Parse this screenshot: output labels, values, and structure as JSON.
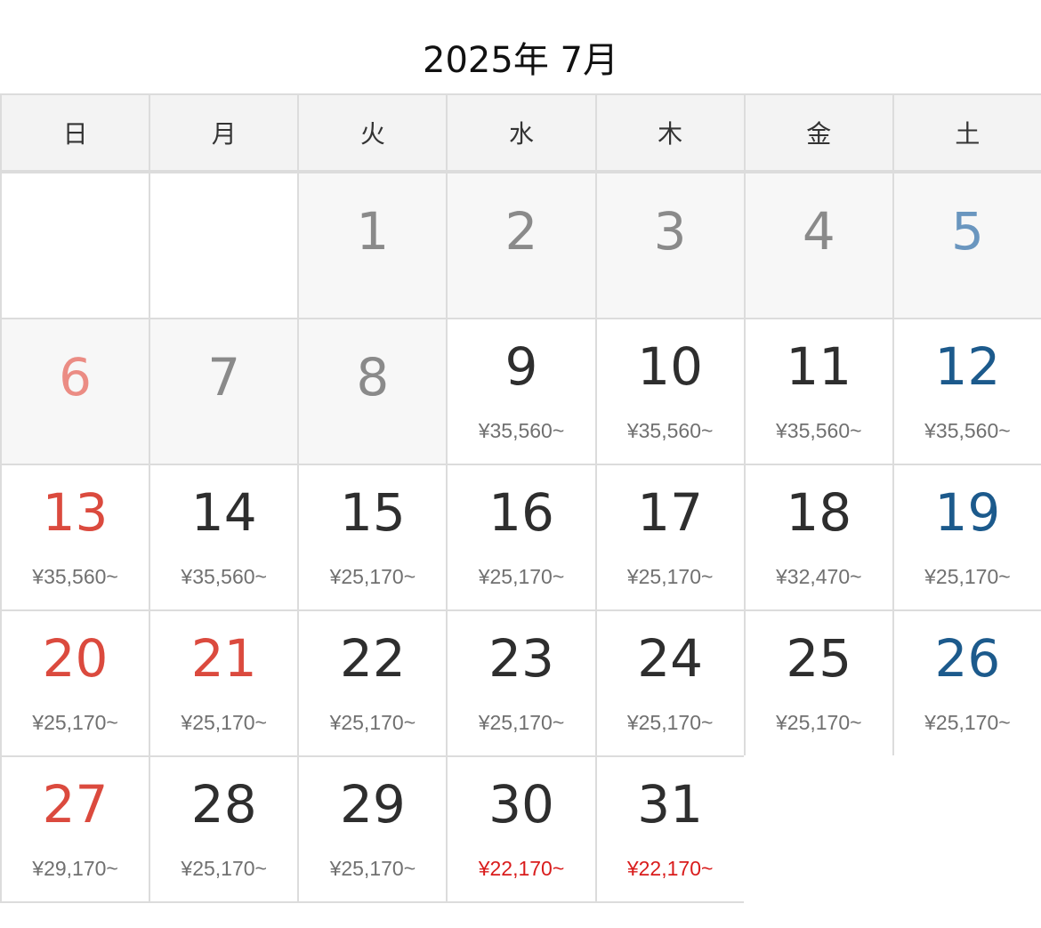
{
  "title": "2025年 7月",
  "weekdays": [
    "日",
    "月",
    "火",
    "水",
    "木",
    "金",
    "土"
  ],
  "weeks": [
    [
      {
        "day": "",
        "price": "",
        "state": "empty"
      },
      {
        "day": "",
        "price": "",
        "state": "empty"
      },
      {
        "day": "1",
        "price": "",
        "state": "past"
      },
      {
        "day": "2",
        "price": "",
        "state": "past"
      },
      {
        "day": "3",
        "price": "",
        "state": "past"
      },
      {
        "day": "4",
        "price": "",
        "state": "past"
      },
      {
        "day": "5",
        "price": "",
        "state": "past"
      }
    ],
    [
      {
        "day": "6",
        "price": "",
        "state": "past"
      },
      {
        "day": "7",
        "price": "",
        "state": "past"
      },
      {
        "day": "8",
        "price": "",
        "state": "past"
      },
      {
        "day": "9",
        "price": "¥35,560~",
        "state": "available"
      },
      {
        "day": "10",
        "price": "¥35,560~",
        "state": "available"
      },
      {
        "day": "11",
        "price": "¥35,560~",
        "state": "available"
      },
      {
        "day": "12",
        "price": "¥35,560~",
        "state": "available"
      }
    ],
    [
      {
        "day": "13",
        "price": "¥35,560~",
        "state": "available"
      },
      {
        "day": "14",
        "price": "¥35,560~",
        "state": "available"
      },
      {
        "day": "15",
        "price": "¥25,170~",
        "state": "available"
      },
      {
        "day": "16",
        "price": "¥25,170~",
        "state": "available"
      },
      {
        "day": "17",
        "price": "¥25,170~",
        "state": "available"
      },
      {
        "day": "18",
        "price": "¥32,470~",
        "state": "available"
      },
      {
        "day": "19",
        "price": "¥25,170~",
        "state": "available"
      }
    ],
    [
      {
        "day": "20",
        "price": "¥25,170~",
        "state": "available"
      },
      {
        "day": "21",
        "price": "¥25,170~",
        "state": "available",
        "holiday": true
      },
      {
        "day": "22",
        "price": "¥25,170~",
        "state": "available"
      },
      {
        "day": "23",
        "price": "¥25,170~",
        "state": "available"
      },
      {
        "day": "24",
        "price": "¥25,170~",
        "state": "available"
      },
      {
        "day": "25",
        "price": "¥25,170~",
        "state": "available"
      },
      {
        "day": "26",
        "price": "¥25,170~",
        "state": "available"
      }
    ],
    [
      {
        "day": "27",
        "price": "¥29,170~",
        "state": "available"
      },
      {
        "day": "28",
        "price": "¥25,170~",
        "state": "available"
      },
      {
        "day": "29",
        "price": "¥25,170~",
        "state": "available"
      },
      {
        "day": "30",
        "price": "¥22,170~",
        "state": "available",
        "lowest": true
      },
      {
        "day": "31",
        "price": "¥22,170~",
        "state": "available",
        "lowest": true
      },
      {
        "day": "",
        "price": "",
        "state": "none"
      },
      {
        "day": "",
        "price": "",
        "state": "none"
      }
    ]
  ],
  "colors": {
    "sunday_holiday": "#db4a3e",
    "saturday": "#1c5a8c",
    "lowest_price": "#d91c1c",
    "border": "#dcdcdc",
    "header_bg": "#f3f3f3",
    "past_bg": "#f7f7f7"
  }
}
